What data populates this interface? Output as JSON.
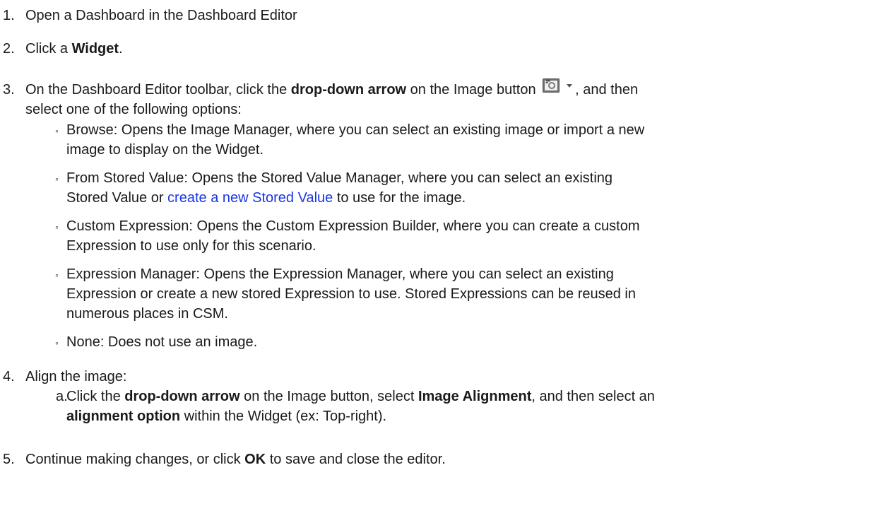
{
  "steps": [
    {
      "number": "1.",
      "text": "Open a Dashboard in the Dashboard Editor"
    },
    {
      "number": "2.",
      "pre": "Click a ",
      "bold": "Widget",
      "post": "."
    },
    {
      "number": "3.",
      "line1_pre": "On the Dashboard Editor toolbar, click the ",
      "line1_bold": "drop-down arrow",
      "line1_mid": " on the Image button ",
      "line1_post": ", and then",
      "line2": "select one of the following options:",
      "image_button_icon": "camera-icon",
      "options": [
        {
          "line1": "Browse: Opens the Image Manager, where you can select an existing image or import a new",
          "line2": "image to display on the Widget."
        },
        {
          "line1": "From Stored Value: Opens the Stored Value Manager, where you can select an existing",
          "line2_pre": "Stored Value or ",
          "line2_link": "create a new Stored Value",
          "line2_post": " to use for the image."
        },
        {
          "line1": "Custom Expression: Opens the Custom Expression Builder, where you can create a custom",
          "line2": "Expression to use only for this scenario."
        },
        {
          "line1": "Expression Manager: Opens the Expression Manager, where you can select an existing",
          "line2": "Expression or create a new stored Expression to use. Stored Expressions can be reused in",
          "line3": "numerous places in CSM."
        },
        {
          "line1": "None: Does not use an image."
        }
      ]
    },
    {
      "number": "4.",
      "text": "Align the image:",
      "sub_letter": "a.",
      "sub_line1_pre": "Click the ",
      "sub_line1_bold1": "drop-down arrow",
      "sub_line1_mid": " on the Image button, select ",
      "sub_line1_bold2": "Image Alignment",
      "sub_line1_post": ", and then select an",
      "sub_line2_bold": "alignment option",
      "sub_line2_post": " within the Widget (ex: Top-right)."
    },
    {
      "number": "5.",
      "pre": "Continue making changes, or click ",
      "bold": "OK",
      "post": " to save and close the editor."
    }
  ],
  "colors": {
    "text": "#1a1a1a",
    "link": "#1a35e6"
  }
}
